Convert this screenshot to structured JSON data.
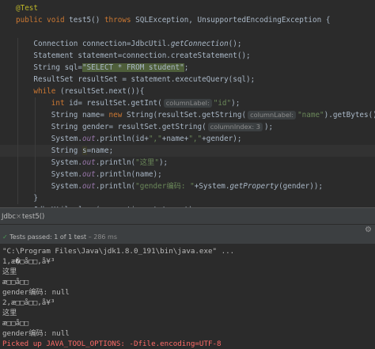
{
  "editor": {
    "lines": [
      [
        {
          "t": "@Test",
          "c": "ann"
        }
      ],
      [
        {
          "t": "public void ",
          "c": "kw"
        },
        {
          "t": "test5() "
        },
        {
          "t": "throws ",
          "c": "kw"
        },
        {
          "t": "SQLException, UnsupportedEncodingException {"
        }
      ],
      [],
      [
        {
          "t": "    Connection connection=JdbcUtil."
        },
        {
          "t": "getConnection",
          "c": "ital"
        },
        {
          "t": "();"
        }
      ],
      [
        {
          "t": "    Statement statement=connection.createStatement();"
        }
      ],
      [
        {
          "t": "    String sql="
        },
        {
          "t": "\"SELECT * FROM student\"",
          "c": "sqlhl"
        },
        {
          "t": ";"
        }
      ],
      [
        {
          "t": "    ResultSet resultSet = statement.executeQuery(sql);"
        }
      ],
      [
        {
          "t": "    "
        },
        {
          "t": "while ",
          "c": "kw"
        },
        {
          "t": "(resultSet.next()){"
        }
      ],
      [
        {
          "t": "        "
        },
        {
          "t": "int ",
          "c": "kw"
        },
        {
          "t": "id= resultSet.getInt("
        },
        {
          "t": "columnLabel:",
          "c": "hint"
        },
        {
          "t": "\"id\"",
          "c": "str"
        },
        {
          "t": ");"
        }
      ],
      [
        {
          "t": "        String name= "
        },
        {
          "t": "new ",
          "c": "kw"
        },
        {
          "t": "String(resultSet.getString("
        },
        {
          "t": "columnLabel:",
          "c": "hint"
        },
        {
          "t": "\"name\"",
          "c": "str"
        },
        {
          "t": ").getBytes(),"
        }
      ],
      [
        {
          "t": "        String gender= resultSet.getString("
        },
        {
          "t": "columnIndex: 3",
          "c": "hint"
        },
        {
          "t": ");"
        }
      ],
      [
        {
          "t": "        System."
        },
        {
          "t": "out",
          "c": "fld"
        },
        {
          "t": ".println(id+"
        },
        {
          "t": "\",\"",
          "c": "str"
        },
        {
          "t": "+name+"
        },
        {
          "t": "\",\"",
          "c": "str"
        },
        {
          "t": "+gender);"
        }
      ],
      [
        {
          "t": "        String "
        },
        {
          "t": "s",
          "c": "hl"
        },
        {
          "t": "=name;"
        }
      ],
      [
        {
          "t": "        System."
        },
        {
          "t": "out",
          "c": "fld"
        },
        {
          "t": ".println("
        },
        {
          "t": "\"这里\"",
          "c": "str"
        },
        {
          "t": ");"
        }
      ],
      [
        {
          "t": "        System."
        },
        {
          "t": "out",
          "c": "fld"
        },
        {
          "t": ".println(name);"
        }
      ],
      [
        {
          "t": "        System."
        },
        {
          "t": "out",
          "c": "fld"
        },
        {
          "t": ".println("
        },
        {
          "t": "\"gender编码: \"",
          "c": "str"
        },
        {
          "t": "+System."
        },
        {
          "t": "getProperty",
          "c": "ital"
        },
        {
          "t": "(gender));"
        }
      ],
      [
        {
          "t": "    }"
        }
      ],
      [
        {
          "t": "    JdbcUtil."
        },
        {
          "t": "close",
          "c": "ital"
        },
        {
          "t": "(connection,statement);"
        }
      ],
      [
        {
          "t": "}"
        }
      ],
      [
        {
          "t": "}"
        }
      ]
    ]
  },
  "run_tabs": {
    "left": "Jdbc",
    "separator": "×",
    "active": "test5()"
  },
  "status": {
    "passed": "Tests passed: 1 of 1 test",
    "time": "– 286 ms"
  },
  "console": {
    "lines": [
      {
        "t": "\"C:\\Program Files\\Java\\jdk1.8.0_191\\bin\\java.exe\" ...",
        "c": "cmd"
      },
      {
        "t": "1,æ�□å□□,å¥³"
      },
      {
        "t": "这里"
      },
      {
        "t": "æ□□å□□"
      },
      {
        "t": "gender编码: null"
      },
      {
        "t": "2,æ□□å□□,å¥³"
      },
      {
        "t": "这里"
      },
      {
        "t": "æ□□å□□"
      },
      {
        "t": "gender编码: null"
      },
      {
        "t": "Picked up JAVA_TOOL_OPTIONS: -Dfile.encoding=UTF-8",
        "c": "err"
      }
    ]
  },
  "colors": {
    "background": "#2b2b2b",
    "keyword": "#cc7832",
    "string": "#6a8759",
    "annotation": "#bbb529",
    "error": "#ff6b68"
  }
}
